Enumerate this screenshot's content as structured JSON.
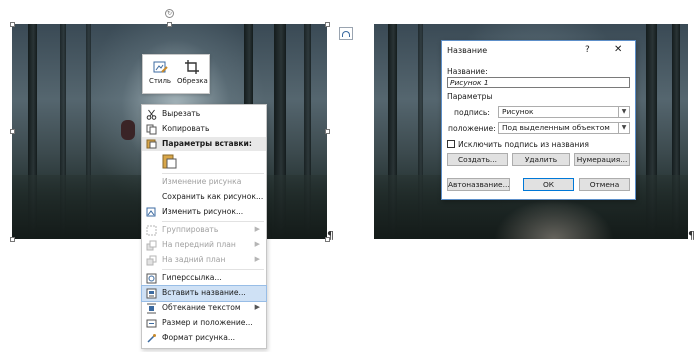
{
  "mini_toolbar": {
    "style_label": "Стиль",
    "crop_label": "Обрезка"
  },
  "context_menu": {
    "items": [
      {
        "label": "Вырезать",
        "icon": "scissors-icon",
        "enabled": true
      },
      {
        "label": "Копировать",
        "icon": "copy-icon",
        "enabled": true
      },
      {
        "label": "Параметры вставки:",
        "icon": "paste-icon",
        "header": true
      },
      {
        "label": "Изменение рисунка",
        "icon": "",
        "enabled": false
      },
      {
        "label": "Сохранить как рисунок...",
        "icon": "",
        "enabled": true
      },
      {
        "label": "Изменить рисунок...",
        "icon": "change-picture-icon",
        "enabled": true
      },
      {
        "label": "Группировать",
        "icon": "group-icon",
        "enabled": false,
        "submenu": true
      },
      {
        "label": "На передний план",
        "icon": "bring-forward-icon",
        "enabled": false,
        "submenu": true
      },
      {
        "label": "На задний план",
        "icon": "send-backward-icon",
        "enabled": false,
        "submenu": true
      },
      {
        "label": "Гиперссылка...",
        "icon": "hyperlink-icon",
        "enabled": true
      },
      {
        "label": "Вставить название...",
        "icon": "insert-caption-icon",
        "enabled": true,
        "highlighted": true
      },
      {
        "label": "Обтекание текстом",
        "icon": "wrap-text-icon",
        "enabled": true,
        "submenu": true
      },
      {
        "label": "Размер и положение...",
        "icon": "size-position-icon",
        "enabled": true
      },
      {
        "label": "Формат рисунка...",
        "icon": "format-picture-icon",
        "enabled": true
      }
    ]
  },
  "dialog": {
    "title": "Название",
    "help": "?",
    "close": "✕",
    "caption_label": "Название:",
    "caption_value": "Рисунок 1",
    "params_label": "Параметры",
    "label_label": "подпись:",
    "label_value": "Рисунок",
    "position_label": "положение:",
    "position_value": "Под выделенным объектом",
    "exclude_label": "Исключить подпись из названия",
    "create_btn": "Создать...",
    "delete_btn": "Удалить",
    "numbering_btn": "Нумерация...",
    "autocaption_btn": "Автоназвание...",
    "ok_btn": "ОК",
    "cancel_btn": "Отмена"
  },
  "document": {
    "pilcrow": "¶",
    "rotate_glyph": "↻",
    "dropdown_glyph": "▼",
    "submenu_glyph": "▶"
  },
  "colors": {
    "highlight": "#cfe1f5",
    "dialog_border": "#5d8fc9",
    "default_button_border": "#0078d7"
  }
}
